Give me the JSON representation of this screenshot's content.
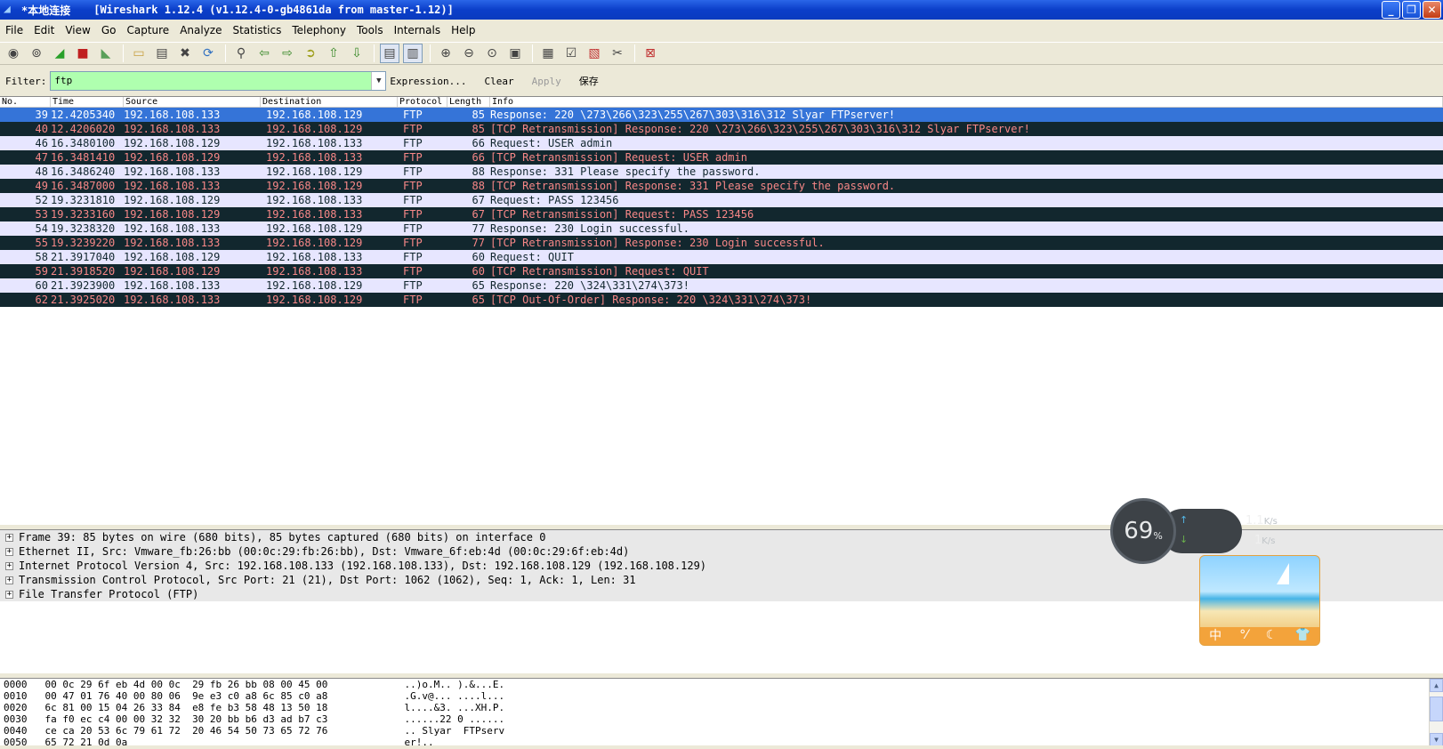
{
  "window": {
    "title_prefix": "*本地连接",
    "title_app": "[Wireshark 1.12.4  (v1.12.4-0-gb4861da from master-1.12)]",
    "buttons": [
      "_",
      "❐",
      "✕"
    ]
  },
  "menu": [
    "File",
    "Edit",
    "View",
    "Go",
    "Capture",
    "Analyze",
    "Statistics",
    "Telephony",
    "Tools",
    "Internals",
    "Help"
  ],
  "filter": {
    "label": "Filter:",
    "value": "ftp",
    "expression": "Expression...",
    "clear": "Clear",
    "apply": "Apply",
    "save": "保存",
    "color": "#afffaf"
  },
  "columns": [
    "No.",
    "Time",
    "Source",
    "Destination",
    "Protocol",
    "Length",
    "Info"
  ],
  "colors": {
    "selected_bg": "#3574d8",
    "normal_bg": "#e7e6ff",
    "bad_bg": "#12272e",
    "bad_fg": "#f78787"
  },
  "packets": [
    {
      "no": "39",
      "time": "12.4205340",
      "src": "192.168.108.133",
      "dst": "192.168.108.129",
      "proto": "FTP",
      "len": "85",
      "info": "Response: 220 \\273\\266\\323\\255\\267\\303\\316\\312 Slyar FTPserver!",
      "style": "sel"
    },
    {
      "no": "40",
      "time": "12.4206020",
      "src": "192.168.108.133",
      "dst": "192.168.108.129",
      "proto": "FTP",
      "len": "85",
      "info": "[TCP Retransmission] Response: 220 \\273\\266\\323\\255\\267\\303\\316\\312 Slyar FTPserver!",
      "style": "bad"
    },
    {
      "no": "46",
      "time": "16.3480100",
      "src": "192.168.108.129",
      "dst": "192.168.108.133",
      "proto": "FTP",
      "len": "66",
      "info": "Request: USER admin",
      "style": "norm"
    },
    {
      "no": "47",
      "time": "16.3481410",
      "src": "192.168.108.129",
      "dst": "192.168.108.133",
      "proto": "FTP",
      "len": "66",
      "info": "[TCP Retransmission] Request: USER admin",
      "style": "bad"
    },
    {
      "no": "48",
      "time": "16.3486240",
      "src": "192.168.108.133",
      "dst": "192.168.108.129",
      "proto": "FTP",
      "len": "88",
      "info": "Response: 331 Please specify the password.",
      "style": "norm"
    },
    {
      "no": "49",
      "time": "16.3487000",
      "src": "192.168.108.133",
      "dst": "192.168.108.129",
      "proto": "FTP",
      "len": "88",
      "info": "[TCP Retransmission] Response: 331 Please specify the password.",
      "style": "bad"
    },
    {
      "no": "52",
      "time": "19.3231810",
      "src": "192.168.108.129",
      "dst": "192.168.108.133",
      "proto": "FTP",
      "len": "67",
      "info": "Request: PASS 123456",
      "style": "norm"
    },
    {
      "no": "53",
      "time": "19.3233160",
      "src": "192.168.108.129",
      "dst": "192.168.108.133",
      "proto": "FTP",
      "len": "67",
      "info": "[TCP Retransmission] Request: PASS 123456",
      "style": "bad"
    },
    {
      "no": "54",
      "time": "19.3238320",
      "src": "192.168.108.133",
      "dst": "192.168.108.129",
      "proto": "FTP",
      "len": "77",
      "info": "Response: 230 Login successful.",
      "style": "norm"
    },
    {
      "no": "55",
      "time": "19.3239220",
      "src": "192.168.108.133",
      "dst": "192.168.108.129",
      "proto": "FTP",
      "len": "77",
      "info": "[TCP Retransmission] Response: 230 Login successful.",
      "style": "bad"
    },
    {
      "no": "58",
      "time": "21.3917040",
      "src": "192.168.108.129",
      "dst": "192.168.108.133",
      "proto": "FTP",
      "len": "60",
      "info": "Request: QUIT",
      "style": "norm"
    },
    {
      "no": "59",
      "time": "21.3918520",
      "src": "192.168.108.129",
      "dst": "192.168.108.133",
      "proto": "FTP",
      "len": "60",
      "info": "[TCP Retransmission] Request: QUIT",
      "style": "bad"
    },
    {
      "no": "60",
      "time": "21.3923900",
      "src": "192.168.108.133",
      "dst": "192.168.108.129",
      "proto": "FTP",
      "len": "65",
      "info": "Response: 220 \\324\\331\\274\\373!",
      "style": "norm"
    },
    {
      "no": "62",
      "time": "21.3925020",
      "src": "192.168.108.133",
      "dst": "192.168.108.129",
      "proto": "FTP",
      "len": "65",
      "info": "[TCP Out-Of-Order] Response: 220 \\324\\331\\274\\373!",
      "style": "bad"
    }
  ],
  "details": [
    "Frame 39: 85 bytes on wire (680 bits), 85 bytes captured (680 bits) on interface 0",
    "Ethernet II, Src: Vmware_fb:26:bb (00:0c:29:fb:26:bb), Dst: Vmware_6f:eb:4d (00:0c:29:6f:eb:4d)",
    "Internet Protocol Version 4, Src: 192.168.108.133 (192.168.108.133), Dst: 192.168.108.129 (192.168.108.129)",
    "Transmission Control Protocol, Src Port: 21 (21), Dst Port: 1062 (1062), Seq: 1, Ack: 1, Len: 31",
    "File Transfer Protocol (FTP)"
  ],
  "bytes": [
    {
      "off": "0000",
      "hex": "00 0c 29 6f eb 4d 00 0c  29 fb 26 bb 08 00 45 00",
      "ascii": "..)o.M.. ).&...E."
    },
    {
      "off": "0010",
      "hex": "00 47 01 76 40 00 80 06  9e e3 c0 a8 6c 85 c0 a8",
      "ascii": ".G.v@... ....l..."
    },
    {
      "off": "0020",
      "hex": "6c 81 00 15 04 26 33 84  e8 fe b3 58 48 13 50 18",
      "ascii": "l....&3. ...XH.P."
    },
    {
      "off": "0030",
      "hex": "fa f0 ec c4 00 00 32 32  30 20 bb b6 d3 ad b7 c3",
      "ascii": "......22 0 ......"
    },
    {
      "off": "0040",
      "hex": "ce ca 20 53 6c 79 61 72  20 46 54 50 73 65 72 76",
      "ascii": ".. Slyar  FTPserv"
    },
    {
      "off": "0050",
      "hex": "65 72 21 0d 0a",
      "ascii": "er!.."
    }
  ],
  "widget": {
    "percent": "69",
    "pct_sign": "%",
    "up_speed": "1.1",
    "down_speed": "1",
    "unit": "K/s",
    "card_chars": [
      "中",
      "°⁄",
      "☾",
      "👕"
    ]
  }
}
